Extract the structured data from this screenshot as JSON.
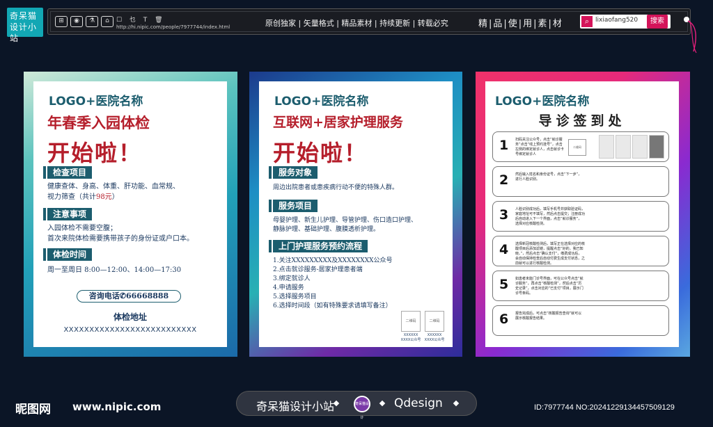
{
  "brand": {
    "logo_line1": "奇呆猫",
    "logo_line2": "设计小站"
  },
  "topbar": {
    "icons": [
      "gift-icon",
      "camera-icon",
      "flask-icon",
      "shop-icon"
    ],
    "small_icons": "☐ 乜 T 🗑",
    "url": "http://hi.nipic.com/people/7977744/index.html",
    "slogan": "原创独家 | 矢量格式 | 精品素材 | 持续更新 | 转载必究",
    "slogan2": "精|品|使|用|素|材",
    "search_value": "lixiaofang520",
    "search_button": "搜索"
  },
  "poster1": {
    "logo": "LOGO+医院名称",
    "headline1": "年春季入园体检",
    "headline2": "开始啦！",
    "sec1_tag": "检查项目",
    "sec1_line1": "健康查体、身高、体重、肝功能、血常规、",
    "sec1_line2a": "视力筛查（共计",
    "sec1_line2b": "98元",
    "sec1_line2c": "）",
    "sec2_tag": "注意事项",
    "sec2_line1": "入园体检不需要空腹；",
    "sec2_line2": "首次来院体检需要携带孩子的身份证或户口本。",
    "sec3_tag": "体检时间",
    "sec3_line1": "周一至周日  8:00—12:00、14:00—17:30",
    "phone": "咨询电话✆66668888",
    "addr_title": "体检地址",
    "addr_value": "XXXXXXXXXXXXXXXXXXXXXXXXXX"
  },
  "poster2": {
    "logo": "LOGO+医院名称",
    "headline1": "互联网+居家护理服务",
    "headline2": "开始啦！",
    "sec1_tag": "服务对象",
    "sec1_line1": "周边出院患者或患疾病行动不便的特殊人群。",
    "sec2_tag": "服务项目",
    "sec2_line1": "母婴护理、新生儿护理、导管护理、伤口造口护理、",
    "sec2_line2": "静脉护理、基础护理、腹膜透析护理。",
    "sec3_tag": "上门护理服务预约流程",
    "steps": [
      "1.关注XXXXXXXXX及XXXXXXXX公众号",
      "2.点击就诊服务-居家护理患者端",
      "3.绑定就诊人",
      "4.申请服务",
      "5.选择服务项目",
      "6.选择时间段（如有特殊要求请填写备注）"
    ],
    "qr1": "二维码",
    "qr2": "二维码",
    "qr1_cap": "XXXXXX",
    "qr1_cap2": "XXXX公众号",
    "qr2_cap": "XXXXXX",
    "qr2_cap2": "XXXX公众号"
  },
  "poster3": {
    "logo": "LOGO+医院名称",
    "title": "导诊签到处",
    "steps": [
      {
        "num": "1",
        "text": "扫码关注公众号，点击“就诊服务”点击“线上预约挂号”，点击左侧的绑定就诊人，点击就诊卡号绑定就诊人"
      },
      {
        "num": "2",
        "text": "然后输入姓名和身份证号，点击“下一步”，进行人脸识别。"
      },
      {
        "num": "3",
        "text": "人脸识别成功后，填写手机号并获取验证码，家庭地址可不填写，然后点击提交；注册成功后自动进入下一个界面，点击“就诊服务”，选择对应核酸检测。"
      },
      {
        "num": "4",
        "text": "选择新冠核酸检测后，填写正在选择对应的核酸项目后添加滤镜，提醒点击“好的，我已知晓。”，然后点击“确认支付”，缴费成功后，会自动保持检查后自动付费生成支付状态，之前就可以进行核酸检测。"
      },
      {
        "num": "5",
        "text": "如患者未能门诊号界面，可在公众号点击“就诊服务”，再点击“核酸检测”，然后点击“历史记录”，点击对应的“已支付”项目，展示门诊号条码。"
      },
      {
        "num": "6",
        "text": "报告完成后，可点击“核酸报告查询”就可以展示核酸报告结果。"
      }
    ],
    "qr": "二维码"
  },
  "footer": {
    "site_logo": "昵图网",
    "site_url": "www.nipic.com",
    "brand": "奇呆猫设计小站",
    "badge": "奇呆猫设计",
    "qdesign": "Qdesign",
    "id_line": "ID:7977744 NO:20241229134457509129"
  }
}
